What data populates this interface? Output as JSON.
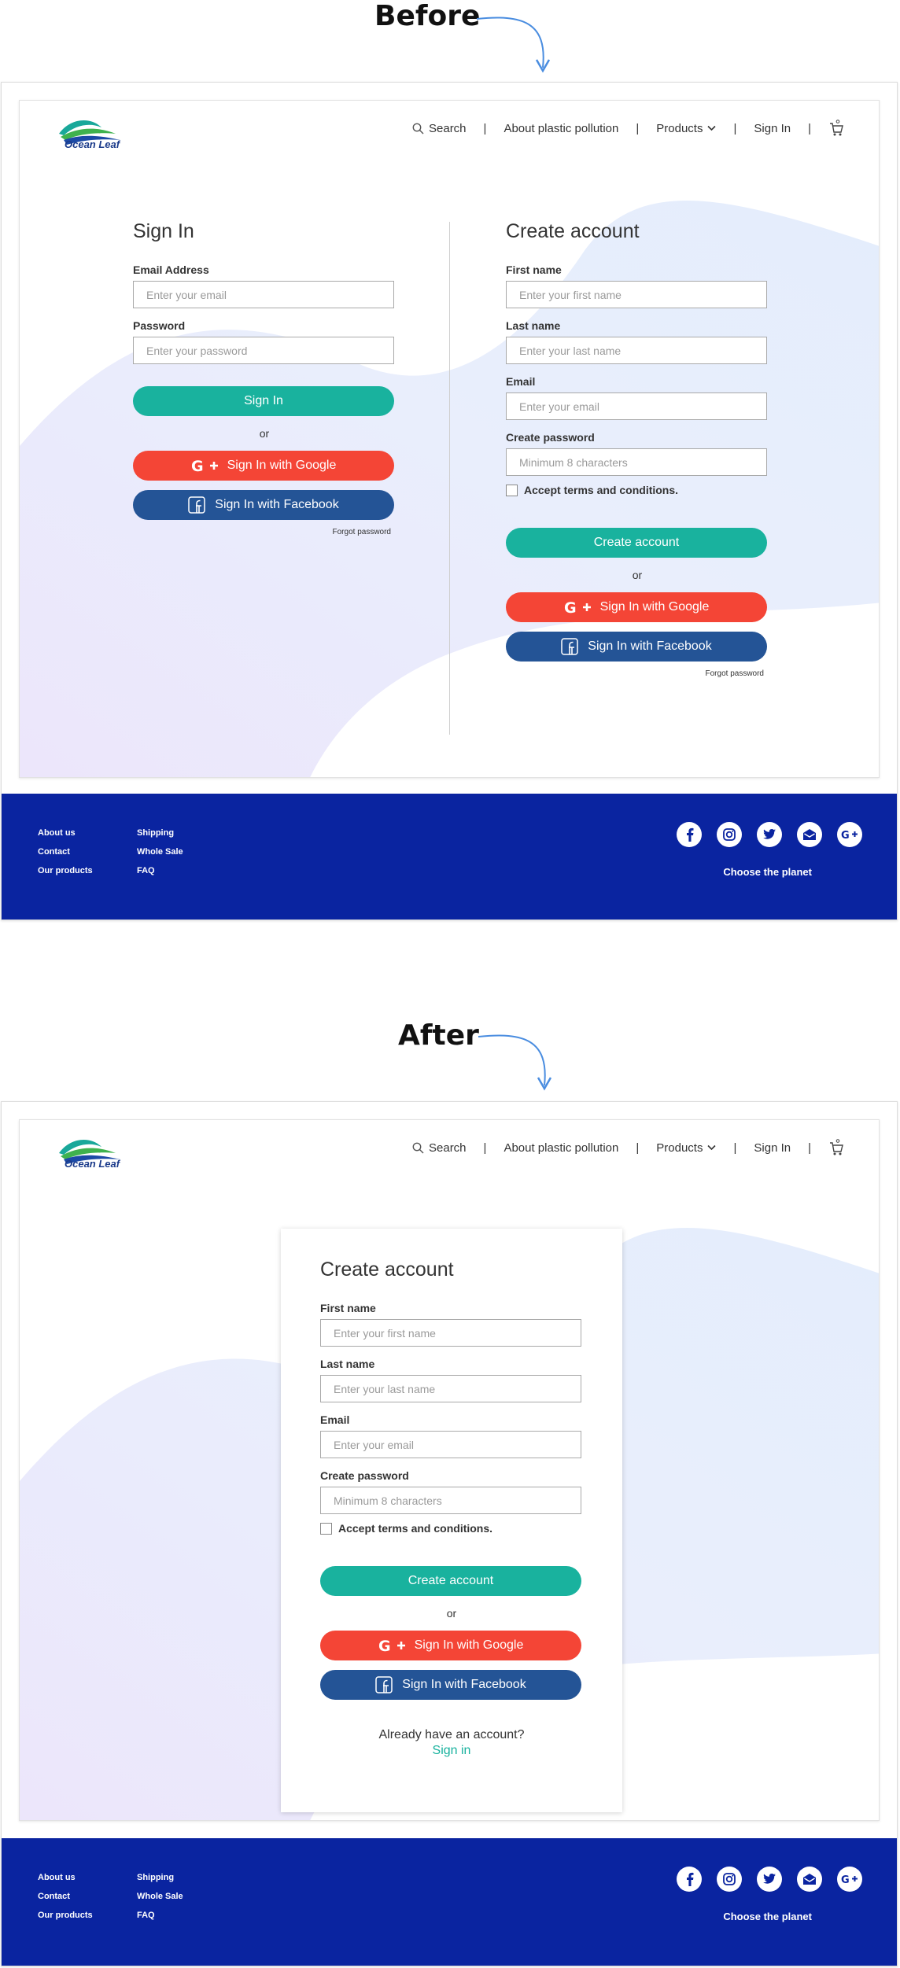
{
  "labels": {
    "before": "Before",
    "after": "After"
  },
  "header": {
    "logo_text": "Ocean Leaf",
    "nav": {
      "search": "Search",
      "about": "About plastic pollution",
      "products": "Products",
      "signin": "Sign In",
      "separator": "|"
    }
  },
  "signin_form": {
    "title": "Sign In",
    "email_label": "Email Address",
    "email_placeholder": "Enter your email",
    "password_label": "Password",
    "password_placeholder": "Enter your password",
    "submit": "Sign In",
    "or": "or",
    "google": "Sign In with Google",
    "facebook": "Sign In with Facebook",
    "forgot": "Forgot password"
  },
  "create_form": {
    "title": "Create account",
    "first_label": "First name",
    "first_placeholder": "Enter your first name",
    "last_label": "Last name",
    "last_placeholder": "Enter your last name",
    "email_label": "Email",
    "email_placeholder": "Enter your email",
    "password_label": "Create password",
    "password_placeholder": "Minimum 8 characters",
    "terms": "Accept terms and conditions.",
    "submit": "Create account",
    "or": "or",
    "google": "Sign In with Google",
    "facebook": "Sign In with Facebook",
    "forgot": "Forgot password",
    "already": "Already have an account?",
    "signin_link": "Sign in"
  },
  "footer": {
    "col1": [
      "About us",
      "Contact",
      "Our products"
    ],
    "col2": [
      "Shipping",
      "Whole Sale",
      "FAQ"
    ],
    "tagline": "Choose the planet",
    "social_icons": [
      "facebook-icon",
      "instagram-icon",
      "twitter-icon",
      "email-icon",
      "google-plus-icon"
    ]
  },
  "colors": {
    "teal": "#19b29e",
    "google": "#f44536",
    "facebook": "#245496",
    "footer": "#0a24a0",
    "link": "#19b29e"
  }
}
